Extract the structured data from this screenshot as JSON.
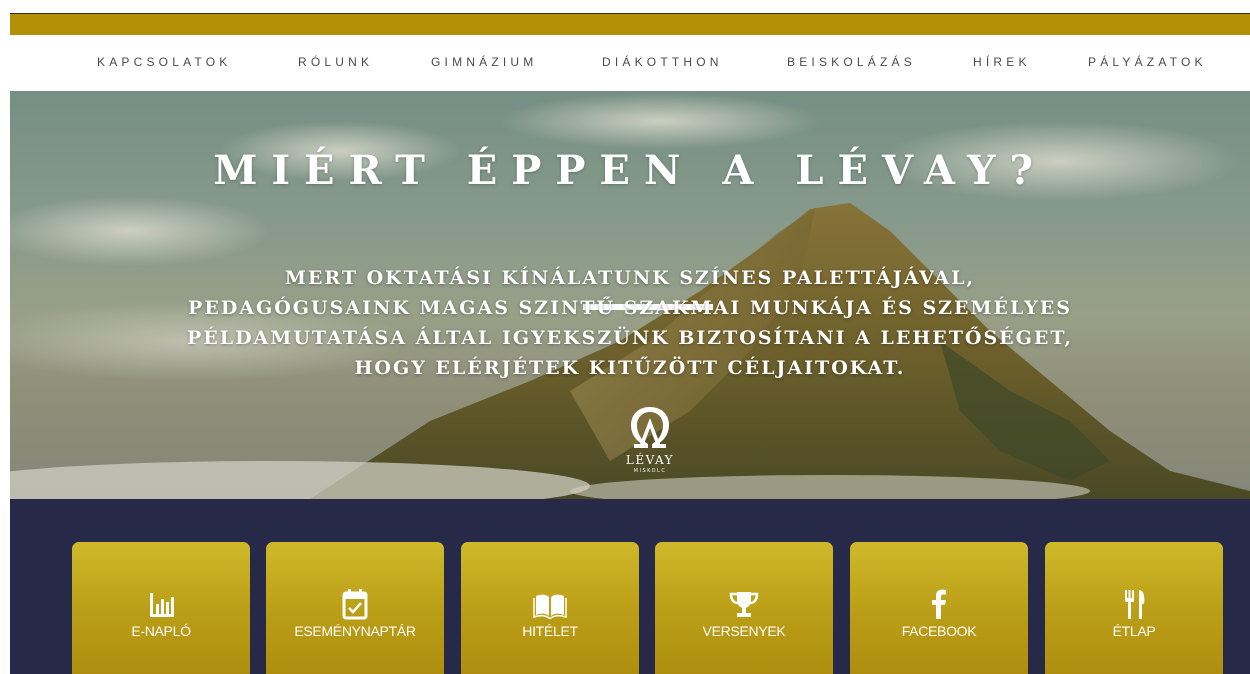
{
  "nav": {
    "items": [
      {
        "label": "KAPCSOLATOK"
      },
      {
        "label": "RÓLUNK"
      },
      {
        "label": "GIMNÁZIUM"
      },
      {
        "label": "DIÁKOTTHON"
      },
      {
        "label": "BEISKOLÁZÁS"
      },
      {
        "label": "HÍREK"
      },
      {
        "label": "PÁLYÁZATOK"
      }
    ]
  },
  "hero": {
    "title": "MIÉRT ÉPPEN A LÉVAY?",
    "text": "MERT OKTATÁSI KÍNÁLATUNK SZÍNES PALETTÁJÁVAL, PEDAGÓGUSAINK MAGAS SZINTŰ SZAKMAI MUNKÁJA ÉS SZEMÉLYES PÉLDAMUTATÁSA ÁLTAL IGYEKSZÜNK BIZTOSÍTANI A LEHETŐSÉGET, HOGY ELÉRJÉTEK KITŰZÖTT CÉLJAITOKAT.",
    "logo": {
      "name": "LÉVAY",
      "city": "MISKOLC"
    }
  },
  "tiles": [
    {
      "label": "E-NAPLÓ",
      "icon": "bar-chart-icon"
    },
    {
      "label": "ESEMÉNYNAPTÁR",
      "icon": "calendar-check-icon"
    },
    {
      "label": "HITÉLET",
      "icon": "open-book-icon"
    },
    {
      "label": "VERSENYEK",
      "icon": "trophy-icon"
    },
    {
      "label": "FACEBOOK",
      "icon": "facebook-icon"
    },
    {
      "label": "ÉTLAP",
      "icon": "fork-knife-icon"
    }
  ],
  "colors": {
    "top_bar": "#b48f08",
    "bottom_band": "#262948",
    "tile_gold": "#bb9e17"
  }
}
